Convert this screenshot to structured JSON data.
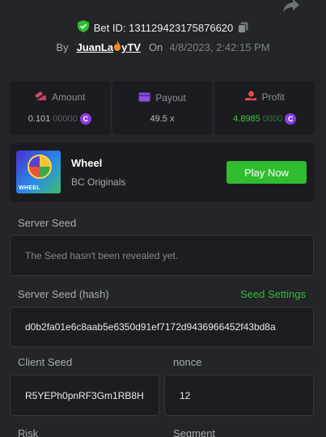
{
  "header": {
    "bet_id_label": "Bet ID: 131129423175876620",
    "by_label": "By",
    "user_name_part1": "JuanLa",
    "user_name_part2": "yTV",
    "on_label": "On",
    "date": "4/8/2023, 2:42:15 PM"
  },
  "stats": {
    "amount": {
      "label": "Amount",
      "value_main": "0.101",
      "value_dim": "00000"
    },
    "payout": {
      "label": "Payout",
      "value": "49.5 x"
    },
    "profit": {
      "label": "Profit",
      "value_main": "4.8985",
      "value_dim": "0000"
    }
  },
  "game": {
    "thumb_tag": "WHEEL",
    "name": "Wheel",
    "provider": "BC Originals",
    "play_label": "Play Now"
  },
  "fairness": {
    "server_seed_label": "Server Seed",
    "server_seed_value": "The Seed hasn't been revealed yet.",
    "server_seed_hash_label": "Server Seed (hash)",
    "seed_settings_label": "Seed Settings",
    "server_seed_hash_value": "d0b2fa01e6c8aab5e6350d91ef7172d9436966452f43bd8a",
    "client_seed_label": "Client Seed",
    "client_seed_value": "R5YEPh0pnRF3Gm1RB8H",
    "nonce_label": "nonce",
    "nonce_value": "12",
    "risk_label": "Risk",
    "segment_label": "Segment"
  },
  "colors": {
    "accent_green": "#2fbd2f",
    "coin_purple": "#8a3de0",
    "background": "#232528",
    "card": "#1b1c1f"
  }
}
